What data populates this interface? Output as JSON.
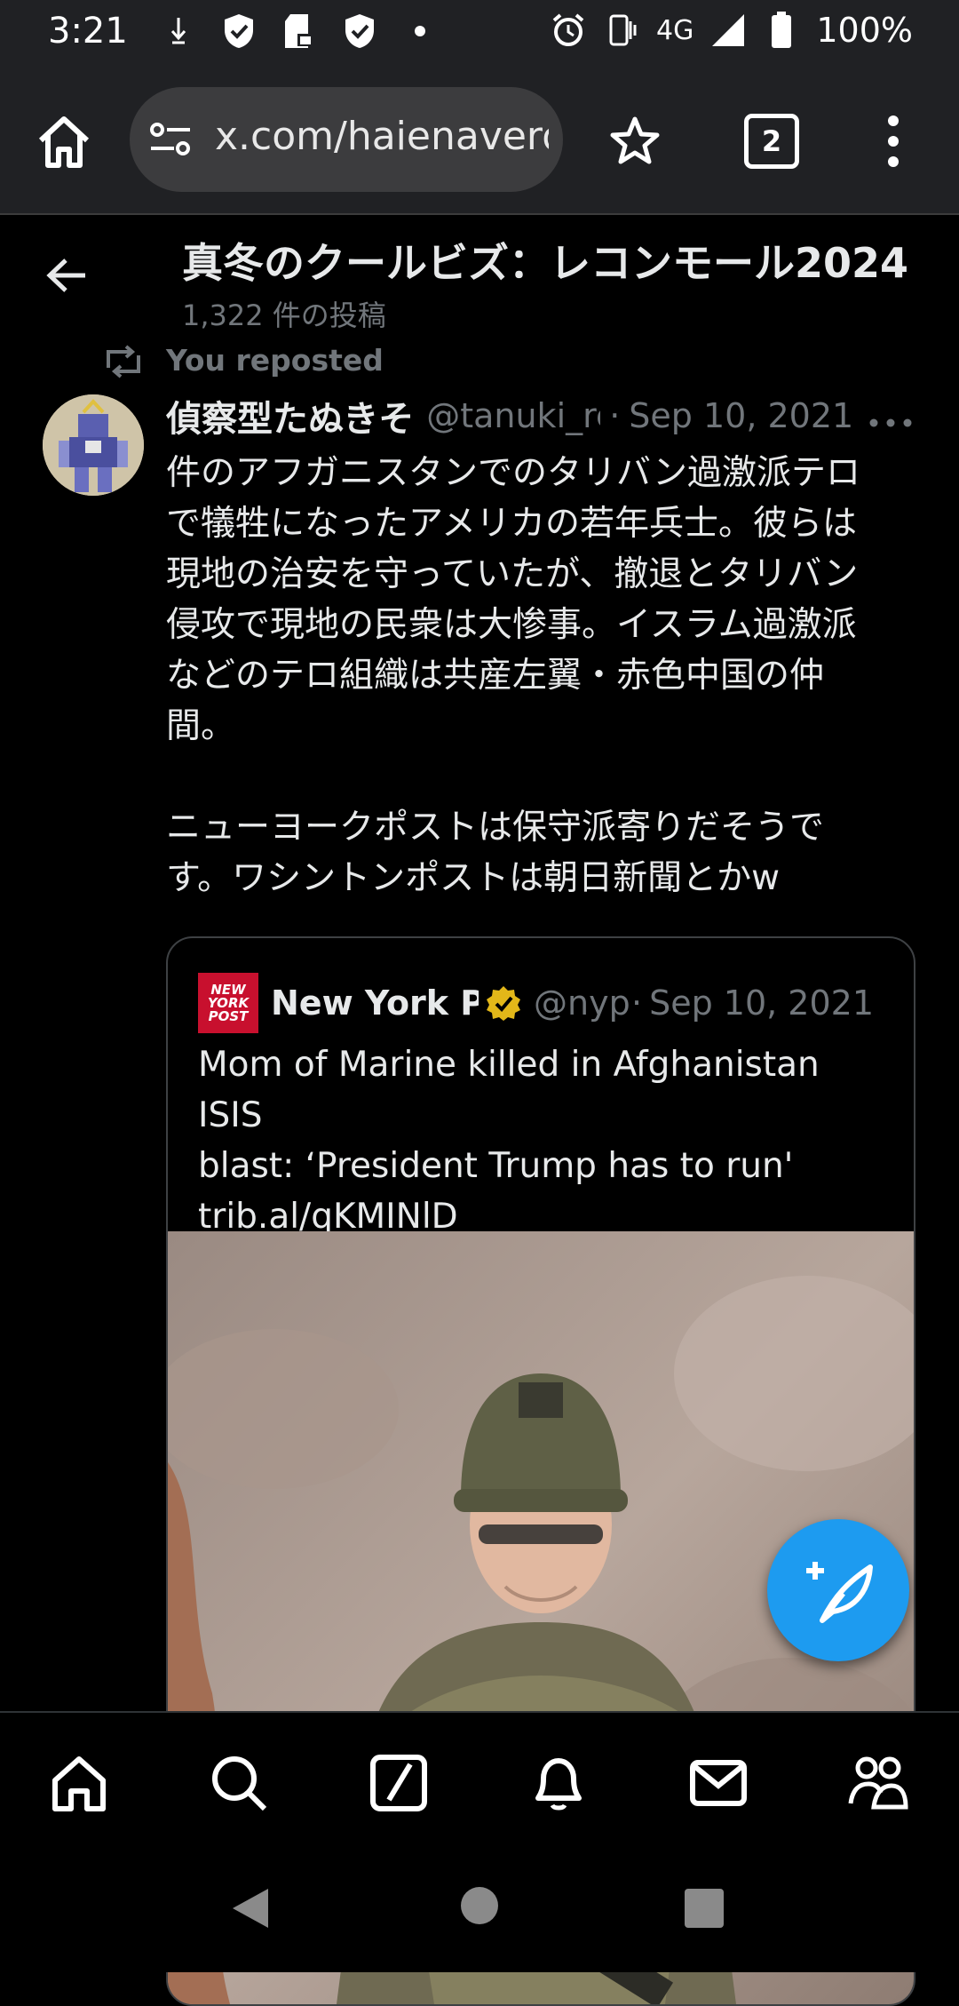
{
  "status_bar": {
    "time": "3:21",
    "network": "4G",
    "battery": "100%",
    "icons": [
      "download-icon",
      "shield-check-icon",
      "sd-card-lock-icon",
      "shield-check-icon",
      "dot-icon",
      "alarm-icon",
      "vibrate-icon",
      "signal-icon",
      "battery-icon"
    ]
  },
  "browser": {
    "url": "x.com/haienaverd",
    "tab_count": "2",
    "icons": [
      "home-icon",
      "site-settings-icon",
      "star-icon",
      "tabs-icon",
      "more-vert-icon"
    ]
  },
  "header": {
    "title": "真冬のクールビズ：レコンモール2024",
    "subtitle": "1,322 件の投稿"
  },
  "repost": {
    "label": "You reposted"
  },
  "tweet": {
    "author_name": "偵察型たぬきそ",
    "handle": "@tanuki_re",
    "separator": "·",
    "date": "Sep 10, 2021",
    "body_lines": [
      "件のアフガニスタンでのタリバン過激派テロ",
      "で犠牲になったアメリカの若年兵士。彼らは",
      "現地の治安を守っていたが、撤退とタリバン",
      "侵攻で現地の民衆は大惨事。イスラム過激派",
      "などのテロ組織は共産左翼・赤色中国の仲",
      "間。"
    ],
    "body_lines_2": [
      "ニューヨークポストは保守派寄りだそうで",
      "す。ワシントンポストは朝日新聞とかw"
    ]
  },
  "quote": {
    "logo_lines": [
      "NEW",
      "YORK",
      "POST"
    ],
    "name": "New York Post",
    "handle": "@nypost",
    "separator": "·",
    "date": "Sep 10, 2021",
    "text_lines": [
      "Mom of Marine killed in Afghanistan ISIS",
      "blast: ‘President Trump has to run'",
      "trib.al/qKMINlD"
    ]
  },
  "bottom_nav": [
    "home-icon",
    "search-icon",
    "grok-icon",
    "notifications-icon",
    "messages-icon",
    "communities-icon"
  ],
  "colors": {
    "accent": "#1d9bf0",
    "background": "#000000",
    "muted_text": "#71767b",
    "verified_gold": "#e2b719",
    "nyp_red": "#c8102e"
  }
}
